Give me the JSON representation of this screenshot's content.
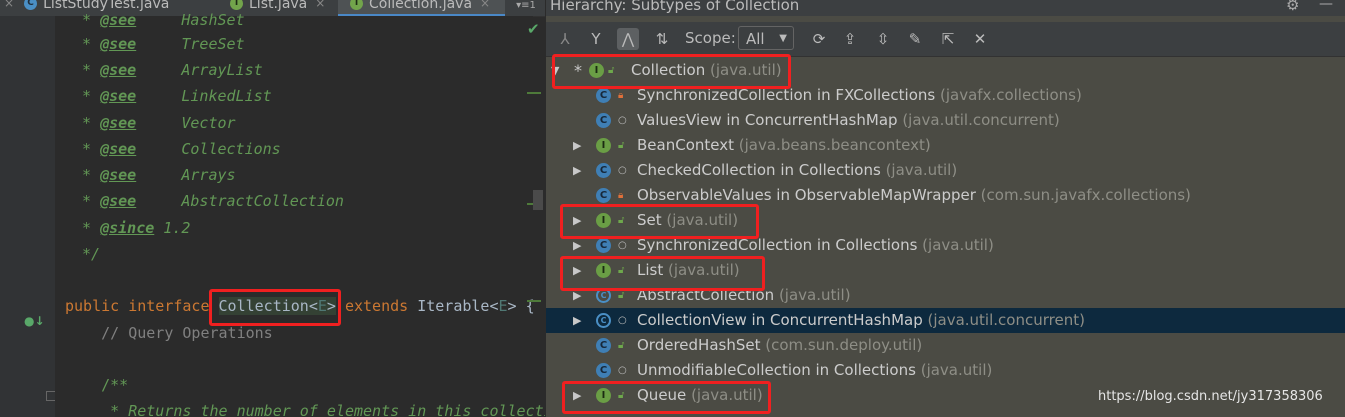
{
  "editor": {
    "tabs": [
      {
        "label": "ListStudyTest.java",
        "icon": "c",
        "icon_glyph": "C",
        "close": "×"
      },
      {
        "label": "List.java",
        "icon": "i",
        "icon_glyph": "I",
        "close": "×"
      },
      {
        "label": "Collection.java",
        "icon": "i",
        "icon_glyph": "I",
        "close": "×",
        "active": true
      }
    ],
    "tab_menu": "▾≡1",
    "code_lines": [
      {
        "prefix": " * ",
        "tag": "@see",
        "text": "     HashSet"
      },
      {
        "prefix": " * ",
        "tag": "@see",
        "text": "     TreeSet"
      },
      {
        "prefix": " * ",
        "tag": "@see",
        "text": "     ArrayList"
      },
      {
        "prefix": " * ",
        "tag": "@see",
        "text": "     LinkedList"
      },
      {
        "prefix": " * ",
        "tag": "@see",
        "text": "     Vector"
      },
      {
        "prefix": " * ",
        "tag": "@see",
        "text": "     Collections"
      },
      {
        "prefix": " * ",
        "tag": "@see",
        "text": "     Arrays"
      },
      {
        "prefix": " * ",
        "tag": "@see",
        "text": "     AbstractCollection"
      },
      {
        "prefix": " * ",
        "tag": "@since",
        "text": " 1.2"
      },
      {
        "prefix": " */",
        "tag": "",
        "text": ""
      }
    ],
    "declaration": {
      "kw1": "public",
      "kw2": "interface",
      "name": "Collection",
      "lt": "<",
      "gen": "E",
      "gt": ">",
      "kw3": "extends",
      "parent": "Iterable",
      "parent_gen": "E",
      "tail": " {"
    },
    "comment_query": "    // Query Operations",
    "doc_open": "    /**",
    "doc_line": "     * Returns the number of elements in this collection"
  },
  "hierarchy": {
    "title": "Hierarchy:  Subtypes of Collection",
    "scope_label": "Scope:",
    "scope_value": "All",
    "toolbar": {
      "supertypes_icon": "⅄",
      "subtypes_icon": "Y",
      "type_hierarchy_icon": "⋀",
      "sort_icon": "⇅",
      "refresh_icon": "⟳",
      "export_icon": "⇪",
      "collapse_icon": "⇳",
      "pin_icon": "✎",
      "autoscroll_icon": "⇱",
      "close_icon": "✕"
    },
    "nodes": [
      {
        "expander": "▼",
        "star": "*",
        "icon": "i",
        "glyph": "I",
        "vis": "pub",
        "name": "Collection",
        "pkg": "(java.util)"
      },
      {
        "expander": "",
        "icon": "c",
        "glyph": "C",
        "vis": "lock",
        "name": "SynchronizedCollection in FXCollections",
        "pkg": "(javafx.collections)"
      },
      {
        "expander": "",
        "icon": "c",
        "glyph": "C",
        "vis": "pkg",
        "name": "ValuesView in ConcurrentHashMap",
        "pkg": "(java.util.concurrent)"
      },
      {
        "expander": "▶",
        "icon": "i",
        "glyph": "I",
        "vis": "pub",
        "name": "BeanContext",
        "pkg": "(java.beans.beancontext)"
      },
      {
        "expander": "▶",
        "icon": "c",
        "glyph": "C",
        "vis": "pkg",
        "name": "CheckedCollection in Collections",
        "pkg": "(java.util)"
      },
      {
        "expander": "",
        "icon": "c",
        "glyph": "C",
        "vis": "lock",
        "name": "ObservableValues in ObservableMapWrapper",
        "pkg": "(com.sun.javafx.collections)"
      },
      {
        "expander": "▶",
        "icon": "i",
        "glyph": "I",
        "vis": "pub",
        "name": "Set",
        "pkg": "(java.util)"
      },
      {
        "expander": "▶",
        "icon": "c",
        "glyph": "C",
        "vis": "pkg",
        "name": "SynchronizedCollection in Collections",
        "pkg": "(java.util)"
      },
      {
        "expander": "▶",
        "icon": "i",
        "glyph": "I",
        "vis": "pub",
        "name": "List",
        "pkg": "(java.util)"
      },
      {
        "expander": "▶",
        "icon": "ca",
        "glyph": "C",
        "vis": "pub",
        "name": "AbstractCollection",
        "pkg": "(java.util)"
      },
      {
        "expander": "▶",
        "icon": "ca",
        "glyph": "C",
        "vis": "pkg",
        "name": "CollectionView in ConcurrentHashMap",
        "pkg": "(java.util.concurrent)",
        "selected": true
      },
      {
        "expander": "",
        "icon": "c",
        "glyph": "C",
        "vis": "pub",
        "name": "OrderedHashSet",
        "pkg": "(com.sun.deploy.util)"
      },
      {
        "expander": "",
        "icon": "c",
        "glyph": "C",
        "vis": "pkg",
        "name": "UnmodifiableCollection in Collections",
        "pkg": "(java.util)"
      },
      {
        "expander": "▶",
        "icon": "i",
        "glyph": "I",
        "vis": "pub",
        "name": "Queue",
        "pkg": "(java.util)"
      }
    ],
    "watermark": "https://blog.csdn.net/jy317358306"
  },
  "colors": {
    "annotation_red": "#f02020",
    "selection": "#0d293e",
    "panel_bg": "#4b4b44",
    "editor_bg": "#2b2b2b"
  }
}
